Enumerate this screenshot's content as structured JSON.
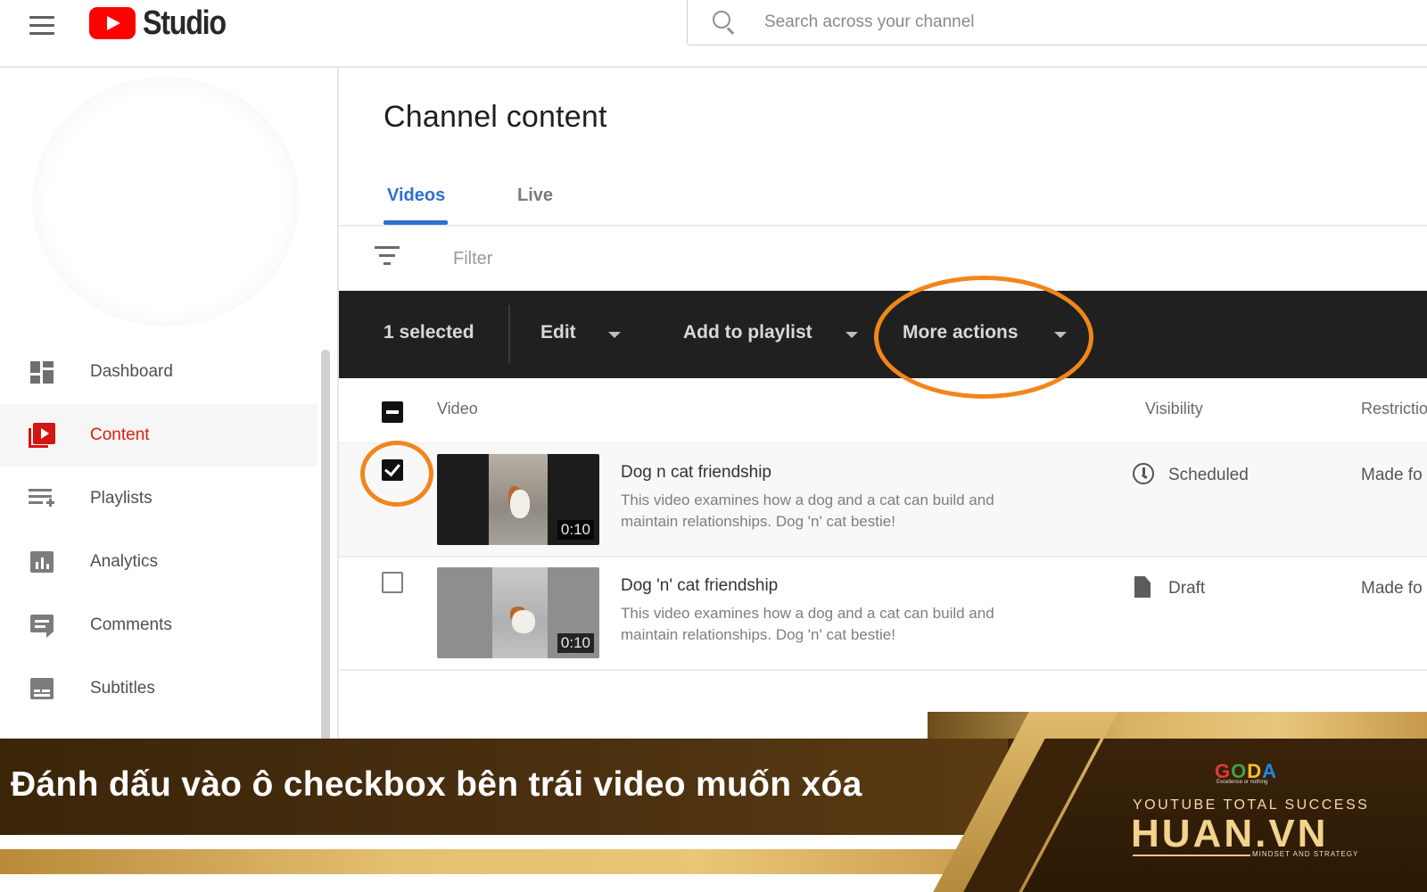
{
  "header": {
    "logo_text": "Studio",
    "search_placeholder": "Search across your channel"
  },
  "sidebar": {
    "items": [
      {
        "label": "Dashboard",
        "icon": "dashboard-icon",
        "active": false
      },
      {
        "label": "Content",
        "icon": "content-icon",
        "active": true
      },
      {
        "label": "Playlists",
        "icon": "playlists-icon",
        "active": false
      },
      {
        "label": "Analytics",
        "icon": "analytics-icon",
        "active": false
      },
      {
        "label": "Comments",
        "icon": "comments-icon",
        "active": false
      },
      {
        "label": "Subtitles",
        "icon": "subtitles-icon",
        "active": false
      }
    ]
  },
  "main": {
    "title": "Channel content",
    "tabs": [
      {
        "label": "Videos",
        "active": true
      },
      {
        "label": "Live",
        "active": false
      }
    ],
    "filter_label": "Filter",
    "action_bar": {
      "selected_count": "1 selected",
      "edit": "Edit",
      "add_to_playlist": "Add to playlist",
      "more_actions": "More actions"
    },
    "table": {
      "columns": [
        "Video",
        "Visibility",
        "Restrictio"
      ],
      "rows": [
        {
          "title": "Dog n cat friendship",
          "description": "This video examines how a dog and a cat can build and maintain relationships. Dog 'n' cat bestie!",
          "duration": "0:10",
          "visibility": "Scheduled",
          "restrictions": "Made fo",
          "checked": true
        },
        {
          "title": "Dog 'n' cat friendship",
          "description": "This video examines how a dog and a cat can build and maintain relationships. Dog 'n' cat bestie!",
          "duration": "0:10",
          "visibility": "Draft",
          "restrictions": "Made fo",
          "checked": false
        }
      ]
    }
  },
  "banner": {
    "caption": "Đánh dấu vào ô checkbox bên trái video muốn xóa",
    "brand_logo": "GODA",
    "brand_logo_tagline": "Excellence or nothing",
    "brand_subtitle": "YOUTUBE TOTAL SUCCESS",
    "brand_name": "HUAN.VN",
    "brand_tagline": "MINDSET AND STRATEGY"
  },
  "colors": {
    "accent_blue": "#2f6fd0",
    "active_red": "#e01b0e",
    "highlight_orange": "#f1861b",
    "action_bar_bg": "#202020",
    "banner_brown": "#4a3010",
    "banner_gold": "#e4c070"
  }
}
